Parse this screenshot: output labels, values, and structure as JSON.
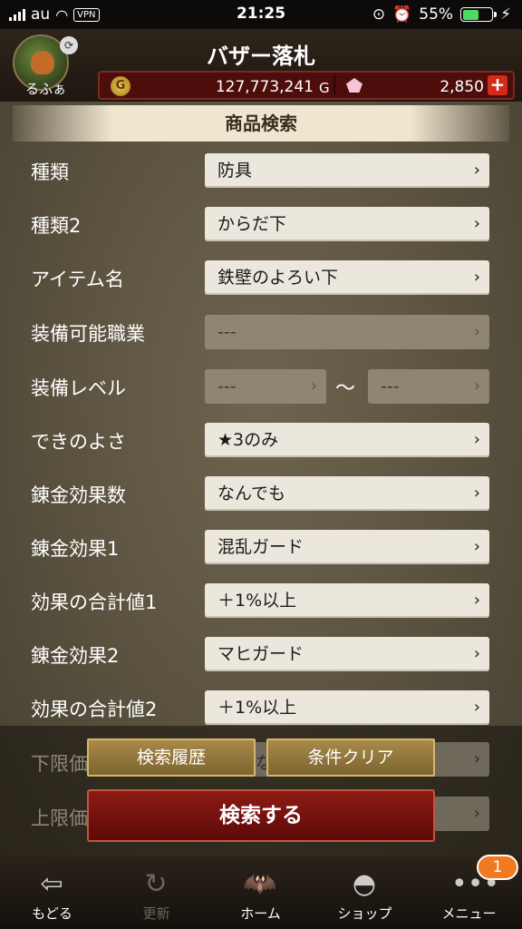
{
  "status_bar": {
    "carrier": "au",
    "vpn": "VPN",
    "time": "21:25",
    "battery_percent": "55%",
    "battery_level": 0.55
  },
  "header": {
    "player_name": "るふぁ",
    "title": "バザー落札",
    "gold_value": "127,773,241",
    "gold_unit": "G",
    "gem_value": "2,850",
    "plus_label": "+"
  },
  "section_title": "商品検索",
  "form": {
    "rows": [
      {
        "label": "種類",
        "value": "防具"
      },
      {
        "label": "種類2",
        "value": "からだ下"
      },
      {
        "label": "アイテム名",
        "value": "鉄壁のよろい下"
      },
      {
        "label": "装備可能職業",
        "value": "---"
      },
      {
        "label": "装備レベル",
        "min": "---",
        "max": "---",
        "separator": "〜"
      },
      {
        "label": "できのよさ",
        "value": "★3のみ"
      },
      {
        "label": "錬金効果数",
        "value": "なんでも"
      },
      {
        "label": "錬金効果1",
        "value": "混乱ガード"
      },
      {
        "label": "効果の合計値1",
        "value": "＋1%以上"
      },
      {
        "label": "錬金効果2",
        "value": "マヒガード"
      },
      {
        "label": "効果の合計値2",
        "value": "＋1%以上"
      },
      {
        "label": "下限価",
        "value": "な"
      },
      {
        "label": "上限価",
        "value": ""
      }
    ],
    "chevron": "›"
  },
  "actions": {
    "history": "検索履歴",
    "clear": "条件クリア",
    "search": "検索する"
  },
  "nav": {
    "back": "もどる",
    "refresh": "更新",
    "home": "ホーム",
    "shop": "ショップ",
    "menu": "メニュー",
    "menu_badge": "1"
  }
}
